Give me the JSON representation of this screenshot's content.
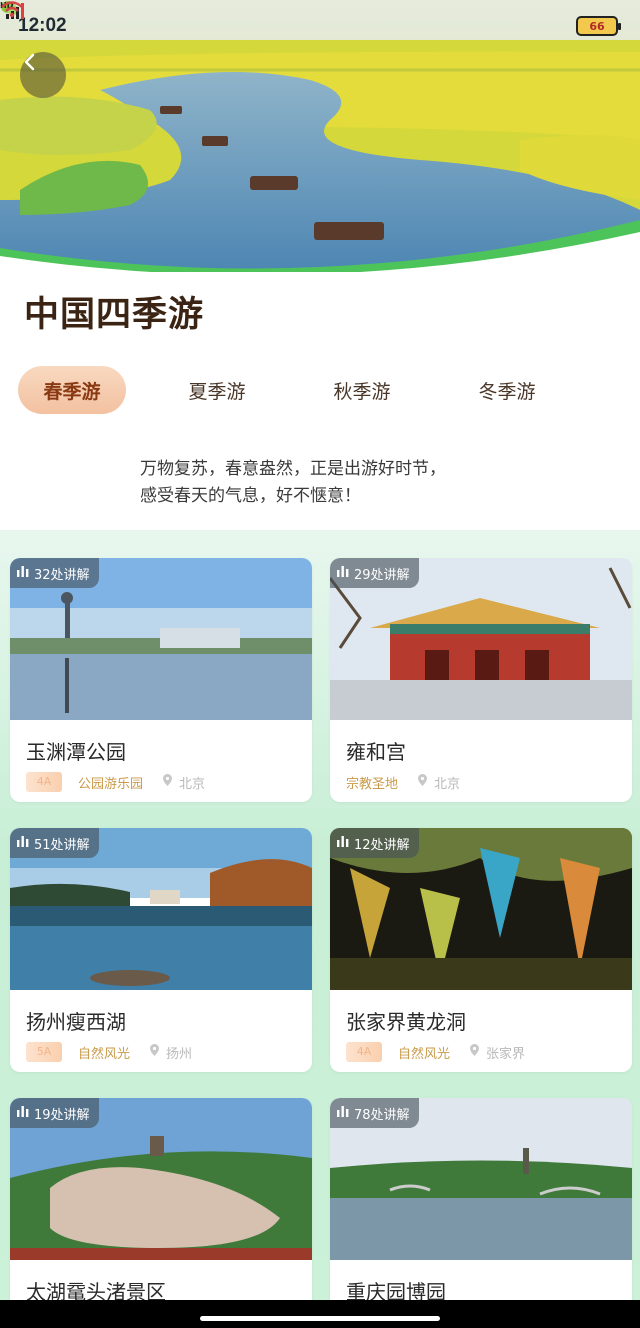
{
  "status_bar": {
    "time": "12:02",
    "battery": "66",
    "network": "HD"
  },
  "page": {
    "title": "中国四季游",
    "intro_line1": "万物复苏，春意盎然，正是出游好时节，",
    "intro_line2": "感受春天的气息，好不惬意！"
  },
  "tabs": [
    {
      "label": "春季游",
      "active": true
    },
    {
      "label": "夏季游",
      "active": false
    },
    {
      "label": "秋季游",
      "active": false
    },
    {
      "label": "冬季游",
      "active": false
    }
  ],
  "cards": [
    {
      "guide": "32处讲解",
      "name": "玉渊潭公园",
      "level": "4A",
      "category": "公园游乐园",
      "location": "北京"
    },
    {
      "guide": "29处讲解",
      "name": "雍和宫",
      "level": "",
      "category": "宗教圣地",
      "location": "北京"
    },
    {
      "guide": "51处讲解",
      "name": "扬州瘦西湖",
      "level": "5A",
      "category": "自然风光",
      "location": "扬州"
    },
    {
      "guide": "12处讲解",
      "name": "张家界黄龙洞",
      "level": "4A",
      "category": "自然风光",
      "location": "张家界"
    },
    {
      "guide": "19处讲解",
      "name": "太湖鼋头渚景区",
      "level": "",
      "category": "",
      "location": ""
    },
    {
      "guide": "78处讲解",
      "name": "重庆园博园",
      "level": "",
      "category": "",
      "location": ""
    }
  ],
  "colors": {
    "tab_active_bg": "#f3c1a0",
    "title": "#3b2414",
    "grid_bg": "#c8efd6",
    "category": "#c99a4a"
  }
}
